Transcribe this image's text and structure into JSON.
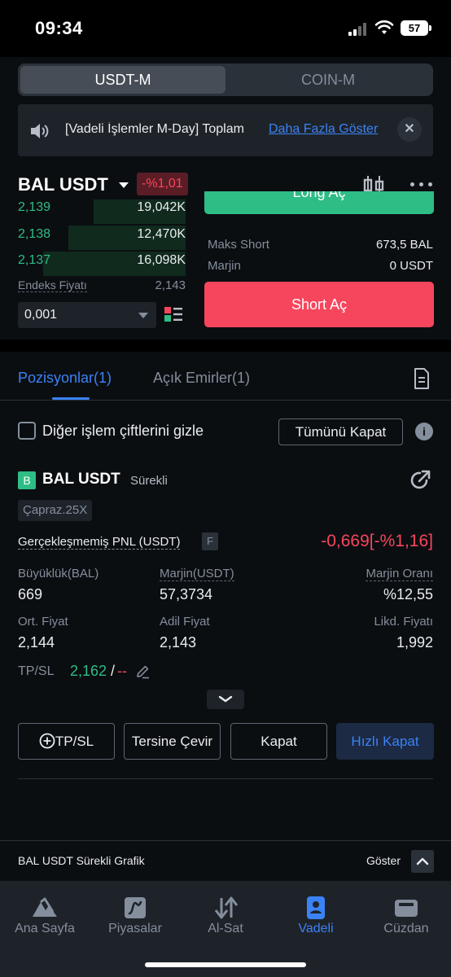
{
  "status": {
    "time": "09:34",
    "battery": "57"
  },
  "segment": {
    "active": "USDT-M",
    "inactive": "COIN-M"
  },
  "announcement": {
    "text": "[Vadeli İşlemler M-Day] Toplam",
    "link": "Daha Fazla Göster"
  },
  "pair": {
    "name": "BAL USDT",
    "change": "-%1,01"
  },
  "orderbook": {
    "rows": [
      {
        "price": "2,139",
        "amount": "19,042K",
        "depth": 0.55
      },
      {
        "price": "2,138",
        "amount": "12,470K",
        "depth": 0.7
      },
      {
        "price": "2,137",
        "amount": "16,098K",
        "depth": 0.85
      }
    ],
    "index_label": "Endeks Fiyatı",
    "index_value": "2,143",
    "step_value": "0,001"
  },
  "trade": {
    "long_label": "Long Aç",
    "max_short_label": "Maks Short",
    "max_short_value": "673,5 BAL",
    "margin_label": "Marjin",
    "margin_value": "0 USDT",
    "short_label": "Short Aç"
  },
  "tabs": {
    "positions": "Pozisyonlar(1)",
    "open_orders": "Açık Emirler(1)"
  },
  "filters": {
    "hide_label": "Diğer işlem çiftlerini gizle",
    "close_all": "Tümünü Kapat"
  },
  "position": {
    "side": "B",
    "pair": "BAL USDT",
    "type": "Sürekli",
    "margin_mode": "Çapraz.25X",
    "pnl_label": "Gerçekleşmemiş PNL (USDT)",
    "pnl_badge": "F",
    "pnl_value": "-0,669[-%1,16]",
    "size_label": "Büyüklük(BAL)",
    "size_value": "669",
    "margin_label": "Marjin(USDT)",
    "margin_value": "57,3734",
    "margin_ratio_label": "Marjin Oranı",
    "margin_ratio_value": "%12,55",
    "entry_label": "Ort. Fiyat",
    "entry_value": "2,144",
    "mark_label": "Adil Fiyat",
    "mark_value": "2,143",
    "liq_label": "Likd. Fiyatı",
    "liq_value": "1,992",
    "tpsl_label": "TP/SL",
    "tp_value": "2,162",
    "tpsl_sep": "/",
    "sl_value": "--"
  },
  "actions": {
    "tpsl": "TP/SL",
    "reverse": "Tersine Çevir",
    "close": "Kapat",
    "quick_close": "Hızlı Kapat"
  },
  "chart_bar": {
    "label": "BAL USDT Sürekli Grafik",
    "show": "Göster"
  },
  "nav": [
    {
      "label": "Ana Sayfa",
      "icon": "home-icon"
    },
    {
      "label": "Piyasalar",
      "icon": "markets-icon"
    },
    {
      "label": "Al-Sat",
      "icon": "trade-icon"
    },
    {
      "label": "Vadeli",
      "icon": "futures-icon"
    },
    {
      "label": "Cüzdan",
      "icon": "wallet-icon"
    }
  ],
  "colors": {
    "accent": "#3b82f6",
    "buy": "#2ebd85",
    "sell": "#f6465d",
    "bg": "#0b0e11"
  }
}
